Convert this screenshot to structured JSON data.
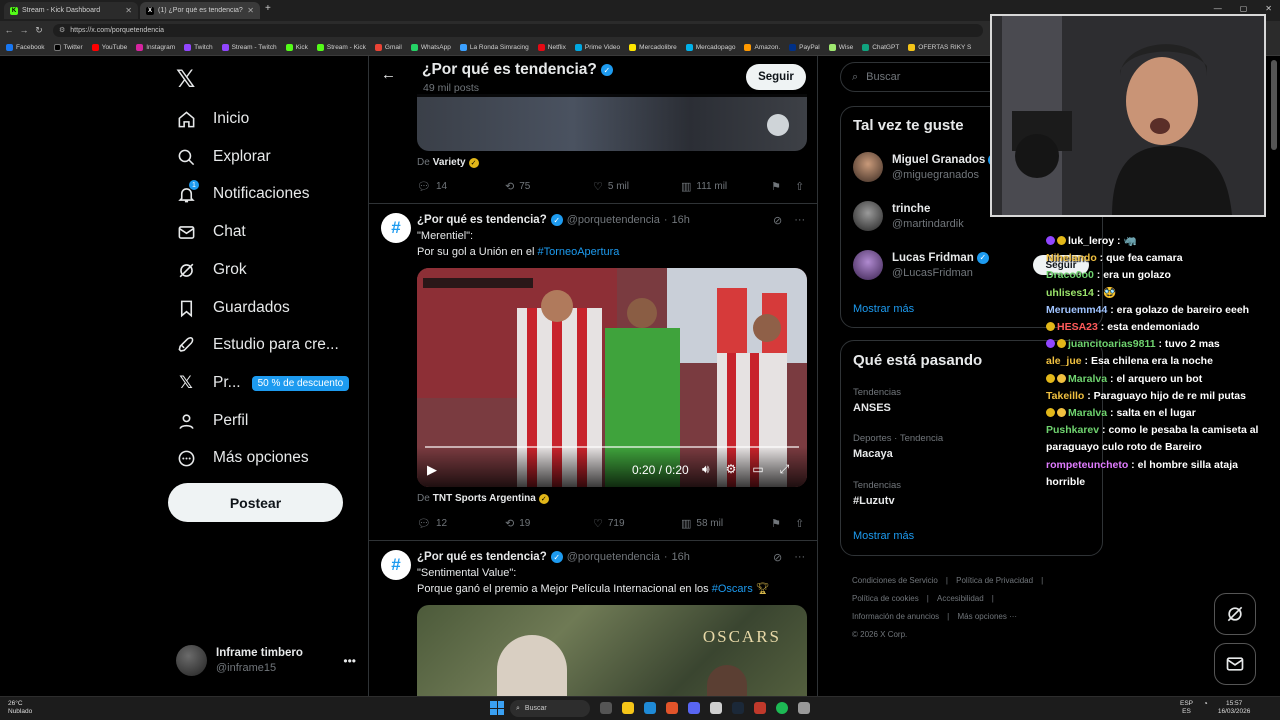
{
  "browser": {
    "tabs": [
      {
        "title": "Stream - Kick Dashboard",
        "favicon": "kick-icon",
        "active": false
      },
      {
        "title": "(1) ¿Por qué es tendencia? (@porq",
        "favicon": "x-icon",
        "active": true
      }
    ],
    "url": "https://x.com/porquetendencia",
    "bookmarks": [
      "Facebook",
      "Twitter",
      "YouTube",
      "Instagram",
      "Twitch",
      "Stream - Twitch",
      "Kick",
      "Stream - Kick",
      "Gmail",
      "WhatsApp",
      "La Ronda Simracing",
      "Netflix",
      "Prime Video",
      "Mercadolibre",
      "Mercadopago",
      "Amazon.",
      "PayPal",
      "Wise",
      "ChatGPT",
      "OFERTAS RIKY S"
    ]
  },
  "nav": {
    "items": [
      {
        "label": "Inicio",
        "icon": "home-icon"
      },
      {
        "label": "Explorar",
        "icon": "search-icon"
      },
      {
        "label": "Notificaciones",
        "icon": "bell-icon",
        "badge": "1"
      },
      {
        "label": "Chat",
        "icon": "mail-icon"
      },
      {
        "label": "Grok",
        "icon": "grok-icon"
      },
      {
        "label": "Guardados",
        "icon": "bookmark-icon"
      },
      {
        "label": "Estudio para cre...",
        "icon": "rocket-icon"
      },
      {
        "label": "Pr...",
        "icon": "x-premium-icon",
        "promo": "50 % de descuento"
      },
      {
        "label": "Perfil",
        "icon": "person-icon"
      },
      {
        "label": "Más opciones",
        "icon": "more-circle-icon"
      }
    ],
    "post_button": "Postear",
    "account": {
      "name": "Inframe timbero",
      "handle": "@inframe15"
    }
  },
  "header": {
    "title": "¿Por qué es tendencia?",
    "posts_count": "49 mil posts",
    "follow_label": "Seguir"
  },
  "posts": [
    {
      "source_prefix": "De",
      "source": "Variety",
      "replies": "14",
      "reposts": "75",
      "likes": "5 mil",
      "views": "111 mil"
    },
    {
      "author": "¿Por qué es tendencia?",
      "handle": "@porquetendencia",
      "time": "16h",
      "line1": "\"Merentiel\":",
      "line2_text": "Por su gol a Unión en el ",
      "line2_hashtag": "#TorneoApertura",
      "video_time": "0:20 / 0:20",
      "source_prefix": "De",
      "source": "TNT Sports Argentina",
      "replies": "12",
      "reposts": "19",
      "likes": "719",
      "views": "58 mil"
    },
    {
      "author": "¿Por qué es tendencia?",
      "handle": "@porquetendencia",
      "time": "16h",
      "line1": "\"Sentimental Value\":",
      "line2_text": "Porque ganó el premio a Mejor Película Internacional en los ",
      "line2_hashtag": "#Oscars",
      "image_text": "OSCARS"
    }
  ],
  "sidebar": {
    "search_placeholder": "Buscar",
    "suggestions_title": "Tal vez te guste",
    "suggestions": [
      {
        "name": "Miguel Granados",
        "handle": "@miguegranados",
        "verified": true
      },
      {
        "name": "trinche",
        "handle": "@martindardik",
        "verified": false
      },
      {
        "name": "Lucas Fridman",
        "handle": "@LucasFridman",
        "verified": true
      }
    ],
    "show_more": "Mostrar más",
    "trends_title": "Qué está pasando",
    "trends": [
      {
        "context": "Tendencias",
        "name": "ANSES"
      },
      {
        "context": "Deportes · Tendencia",
        "name": "Macaya"
      },
      {
        "context": "Tendencias",
        "name": "#Luzutv"
      }
    ],
    "trends_show_more": "Mostrar más",
    "footer": [
      "Condiciones de Servicio",
      "Política de Privacidad",
      "Política de cookies",
      "Accesibilidad",
      "Información de anuncios",
      "Más opciones ···",
      "© 2026 X Corp."
    ]
  },
  "overlay": {
    "seguir": "Seguir",
    "chat": [
      {
        "user": "luk_leroy",
        "color": "#ffffff",
        "msg": "🦏"
      },
      {
        "user": "Nihelando",
        "color": "#f0c040",
        "msg": "que fea camara"
      },
      {
        "user": "Draco0o0",
        "color": "#6fd36f",
        "msg": "era un golazo"
      },
      {
        "user": "uhlises14",
        "color": "#9be46b",
        "msg": "🥸"
      },
      {
        "user": "Meruemm44",
        "color": "#a0c4ff",
        "msg": "era golazo de bareiro eeeh"
      },
      {
        "user": "HESA23",
        "color": "#ff5a5a",
        "msg": "esta endemoniado"
      },
      {
        "user": "juancitoarias9811",
        "color": "#6fd36f",
        "msg": "tuvo 2 mas"
      },
      {
        "user": "ale_jue",
        "color": "#f0c040",
        "msg": "Esa chilena era la noche"
      },
      {
        "user": "Maralva",
        "color": "#6fd36f",
        "msg": "el arquero un bot"
      },
      {
        "user": "Takeillo",
        "color": "#f0c040",
        "msg": "Paraguayo hijo de re mil putas"
      },
      {
        "user": "Maralva",
        "color": "#6fd36f",
        "msg": "salta en el lugar"
      },
      {
        "user": "Pushkarev",
        "color": "#6fd36f",
        "msg": "como le pesaba la camiseta al paraguayo culo roto de Bareiro"
      },
      {
        "user": "rompeteuncheto",
        "color": "#e07cff",
        "msg": "el hombre silla ataja horrible"
      }
    ]
  },
  "taskbar": {
    "weather_temp": "26°C",
    "weather_desc": "Nublado",
    "search": "Buscar",
    "lang": "ESP",
    "lang2": "ES",
    "time": "15:57",
    "date": "16/03/2026"
  }
}
